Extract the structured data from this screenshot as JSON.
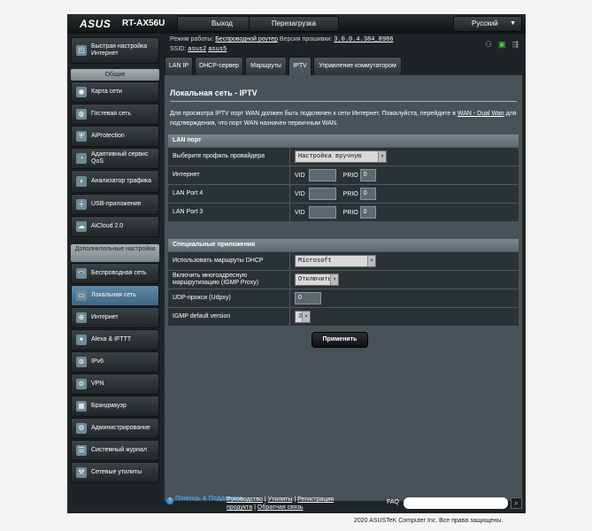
{
  "header": {
    "logo": "ASUS",
    "model": "RT-AX56U",
    "logout_label": "Выход",
    "reboot_label": "Перезагрузка",
    "language": "Русский"
  },
  "info": {
    "mode_label": "Режим работы:",
    "mode_value": "Беспроводной роутер",
    "firmware_label": "Версия прошивки:",
    "firmware_value": "3.0.0.4.384_8986",
    "ssid_label": "SSID:",
    "ssid_1": "asus2",
    "ssid_2": "asus5"
  },
  "sidebar": {
    "quick_setup": "Быстрая настройка Интернет",
    "general_header": "Общие",
    "general": [
      {
        "label": "Карта сети",
        "icon": "network-map-icon"
      },
      {
        "label": "Гостевая сеть",
        "icon": "guest-network-icon"
      },
      {
        "label": "AiProtection",
        "icon": "aiprotection-icon"
      },
      {
        "label": "Адаптивный сервис QoS",
        "icon": "qos-icon"
      },
      {
        "label": "Анализатор трафика",
        "icon": "traffic-analyzer-icon"
      },
      {
        "label": "USB-приложение",
        "icon": "usb-icon"
      },
      {
        "label": "AiCloud 2.0",
        "icon": "aicloud-icon"
      }
    ],
    "advanced_header": "Дополнительные настройки",
    "advanced": [
      {
        "label": "Беспроводная сеть",
        "icon": "wireless-icon"
      },
      {
        "label": "Локальная сеть",
        "icon": "lan-icon"
      },
      {
        "label": "Интернет",
        "icon": "wan-icon"
      },
      {
        "label": "Alexa & IFTTT",
        "icon": "alexa-icon"
      },
      {
        "label": "IPv6",
        "icon": "ipv6-icon"
      },
      {
        "label": "VPN",
        "icon": "vpn-icon"
      },
      {
        "label": "Брандмауэр",
        "icon": "firewall-icon"
      },
      {
        "label": "Администрирование",
        "icon": "administration-icon"
      },
      {
        "label": "Системный журнал",
        "icon": "system-log-icon"
      },
      {
        "label": "Сетевые утилиты",
        "icon": "network-tools-icon"
      }
    ],
    "active": "Локальная сеть"
  },
  "tabs": [
    {
      "label": "LAN IP"
    },
    {
      "label": "DHCP-сервер"
    },
    {
      "label": "Маршруты"
    },
    {
      "label": "IPTV"
    },
    {
      "label": "Управление коммутатором"
    }
  ],
  "active_tab": "IPTV",
  "page": {
    "title": "Локальная сеть - IPTV",
    "desc_1": "Для просмотра IPTV порт WAN должен быть подключен к сети Интернет. Пожалуйста, перейдите в ",
    "desc_link": "WAN - Dual Wan",
    "desc_2": " для подтверждения, что порт WAN назначен первичным WAN."
  },
  "lan_port": {
    "header": "LAN порт",
    "profile_label": "Выберите профиль провайдера",
    "profile_value": "Настройка вручную",
    "vid_label": "VID",
    "prio_label": "PRIO",
    "rows": [
      {
        "label": "Интернет",
        "vid": "",
        "prio": "0"
      },
      {
        "label": "LAN Port 4",
        "vid": "",
        "prio": "0"
      },
      {
        "label": "LAN Port 3",
        "vid": "",
        "prio": "0"
      }
    ]
  },
  "special": {
    "header": "Специальные приложения",
    "dhcp_routes_label": "Использовать маршруты DHCP",
    "dhcp_routes_value": "Microsoft",
    "igmp_proxy_label": "Включить многоадресную маршрутизацию (IGMP Proxy)",
    "igmp_proxy_value": "Отключить",
    "udpxy_label": "UDP-прокси (Udpxy)",
    "udpxy_value": "0",
    "igmp_version_label": "IGMP default version",
    "igmp_version_value": "3"
  },
  "apply_label": "Применить",
  "footer": {
    "help_label": "Помощь & Поддержка",
    "link_manual": "Руководство",
    "link_utility": "Утилиты",
    "link_registration": "Регистрация продукта",
    "link_feedback": "Обратная связь",
    "faq_label": "FAQ",
    "faq_value": ""
  },
  "copyright": "2020 ASUSTeK Computer Inc. Все права защищены."
}
